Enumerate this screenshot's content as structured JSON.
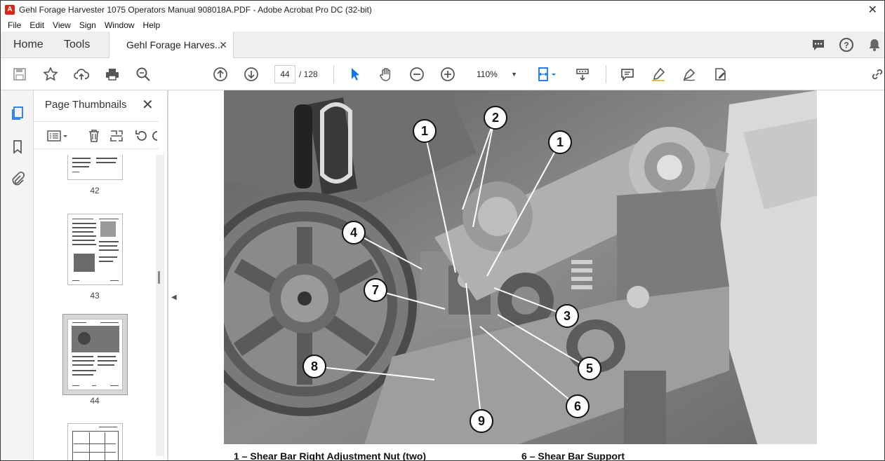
{
  "window": {
    "title": "Gehl Forage Harvester 1075 Operators Manual 908018A.PDF - Adobe Acrobat Pro DC (32-bit)"
  },
  "menu": [
    "File",
    "Edit",
    "View",
    "Sign",
    "Window",
    "Help"
  ],
  "tabs": {
    "home": "Home",
    "tools": "Tools",
    "document": "Gehl Forage Harves..."
  },
  "toolbar": {
    "current_page": "44",
    "total_pages": "/ 128",
    "zoom": "110%"
  },
  "thumbnails": {
    "title": "Page Thumbnails",
    "pages": [
      {
        "label": "42"
      },
      {
        "label": "43"
      },
      {
        "label": "44",
        "selected": true
      },
      {
        "label": ""
      }
    ]
  },
  "figure": {
    "callouts": [
      "1",
      "2",
      "1",
      "4",
      "7",
      "3",
      "5",
      "8",
      "6",
      "9"
    ]
  },
  "captions": {
    "left": "1 – Shear Bar Right Adjustment Nut (two)",
    "right": "6 – Shear Bar Support"
  },
  "icons": {
    "left_nav": [
      "pages-icon",
      "bookmark-icon",
      "attachment-icon"
    ],
    "tab_right": [
      "comment-icon",
      "help-icon",
      "bell-icon"
    ]
  }
}
